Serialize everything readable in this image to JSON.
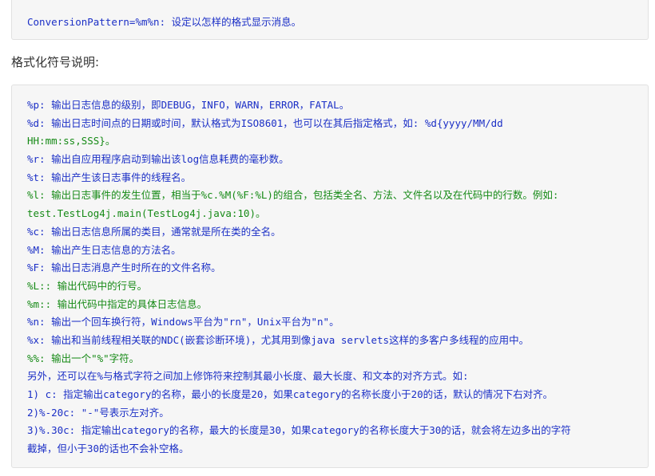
{
  "top_block": {
    "line": "ConversionPattern=%m%n: 设定以怎样的格式显示消息。"
  },
  "heading": "格式化符号说明:",
  "main_block": {
    "lines": [
      {
        "text": "%p: 输出日志信息的级别，即DEBUG，INFO，WARN，ERROR，FATAL。",
        "color": "#1b2fc6"
      },
      {
        "text": "%d: 输出日志时间点的日期或时间，默认格式为ISO8601，也可以在其后指定格式，如: %d{yyyy/MM/dd",
        "color": "#1b2fc6"
      },
      {
        "text": "HH:mm:ss,SSS}。",
        "color": "#168a16"
      },
      {
        "text": "%r: 输出自应用程序启动到输出该log信息耗费的毫秒数。",
        "color": "#1b2fc6"
      },
      {
        "text": "%t: 输出产生该日志事件的线程名。",
        "color": "#1b2fc6"
      },
      {
        "text": "%l: 输出日志事件的发生位置，相当于%c.%M(%F:%L)的组合，包括类全名、方法、文件名以及在代码中的行数。例如:",
        "color": "#168a16"
      },
      {
        "text": "test.TestLog4j.main(TestLog4j.java:10)。",
        "color": "#168a16"
      },
      {
        "text": "%c: 输出日志信息所属的类目，通常就是所在类的全名。",
        "color": "#1b2fc6"
      },
      {
        "text": "%M: 输出产生日志信息的方法名。",
        "color": "#1b2fc6"
      },
      {
        "text": "%F: 输出日志消息产生时所在的文件名称。",
        "color": "#1b2fc6"
      },
      {
        "text": "%L:: 输出代码中的行号。",
        "color": "#168a16"
      },
      {
        "text": "%m:: 输出代码中指定的具体日志信息。",
        "color": "#168a16"
      },
      {
        "text": "%n: 输出一个回车换行符，Windows平台为\"rn\"，Unix平台为\"n\"。",
        "color": "#1b2fc6"
      },
      {
        "text": "%x: 输出和当前线程相关联的NDC(嵌套诊断环境)，尤其用到像java servlets这样的多客户多线程的应用中。",
        "color": "#1b2fc6"
      },
      {
        "text": "%%: 输出一个\"%\"字符。",
        "color": "#168a16"
      },
      {
        "text": "另外，还可以在%与格式字符之间加上修饰符来控制其最小长度、最大长度、和文本的对齐方式。如:",
        "color": "#1b2fc6"
      },
      {
        "text": "1) c: 指定输出category的名称，最小的长度是20，如果category的名称长度小于20的话，默认的情况下右对齐。",
        "color": "#1b2fc6"
      },
      {
        "text": "2)%-20c: \"-\"号表示左对齐。",
        "color": "#1b2fc6"
      },
      {
        "text": "3)%.30c: 指定输出category的名称，最大的长度是30，如果category的名称长度大于30的话，就会将左边多出的字符",
        "color": "#1b2fc6"
      },
      {
        "text": "截掉，但小于30的话也不会补空格。",
        "color": "#1b2fc6"
      }
    ]
  },
  "colors": {
    "code_background": "#f6f6f6",
    "code_border": "#e1e1e1",
    "blue_text": "#1b2fc6",
    "green_text": "#168a16",
    "heading_text": "#333333"
  }
}
